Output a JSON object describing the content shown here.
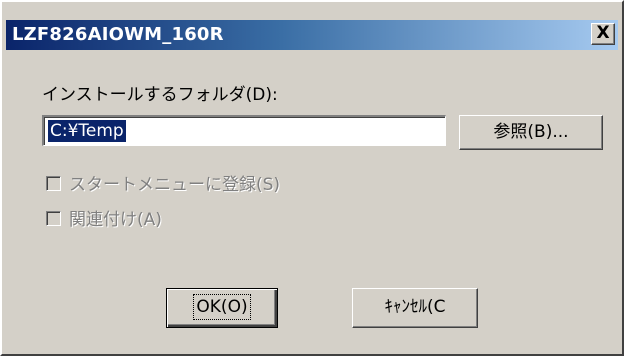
{
  "window": {
    "title": "LZF826AIOWM_160R",
    "close_glyph": "X"
  },
  "folder": {
    "label": "インストールするフォルダ(D):",
    "path_value": "C:¥Temp"
  },
  "buttons": {
    "browse": "参照(B)...",
    "ok": "OK(O)",
    "cancel": "ｷｬﾝｾﾙ(C"
  },
  "options": {
    "start_menu": {
      "label": "スタートメニューに登録(S)",
      "checked": false,
      "enabled": false
    },
    "associate": {
      "label": "関連付け(A)",
      "checked": false,
      "enabled": false
    }
  },
  "colors": {
    "title_start": "#0a246a",
    "title_end": "#a6caf0",
    "face": "#d4d0c8",
    "selection": "#0a246a",
    "disabled_text": "#808080"
  }
}
